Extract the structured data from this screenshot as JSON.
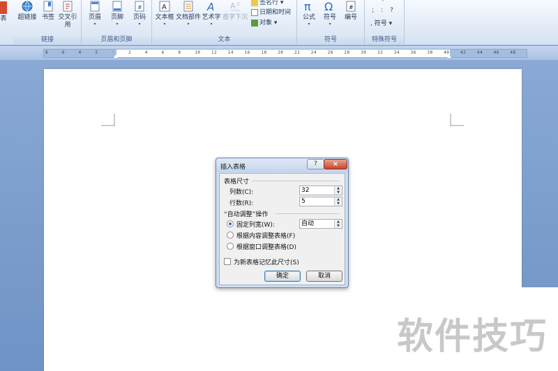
{
  "ribbon": {
    "groups": [
      {
        "id": "links",
        "label": "链接",
        "buttons": [
          "超链接",
          "书签",
          "交叉引用"
        ]
      },
      {
        "id": "header-footer",
        "label": "页眉和页脚",
        "buttons": [
          "页眉",
          "页脚",
          "页码"
        ]
      },
      {
        "id": "text",
        "label": "文本",
        "buttons": [
          "文本框",
          "文档部件",
          "艺术字",
          "首字下沉"
        ],
        "small": [
          "签名行",
          "日期和时间",
          "对象"
        ]
      },
      {
        "id": "symbols",
        "label": "符号",
        "buttons": [
          "公式",
          "符号",
          "编号"
        ]
      },
      {
        "id": "special",
        "label": "特殊符号",
        "small_symbol": "符号"
      }
    ],
    "left_partial": "表",
    "cross_ref_line2": "引用",
    "special_marks": [
      "°",
      "·",
      ";",
      "“",
      "?",
      ",",
      ":"
    ]
  },
  "ruler": {
    "ticks": [
      "8",
      "6",
      "4",
      "2",
      "",
      "2",
      "4",
      "6",
      "8",
      "10",
      "12",
      "14",
      "16",
      "18",
      "20",
      "22",
      "24",
      "26",
      "28",
      "30",
      "32",
      "34",
      "36",
      "38",
      "40",
      "42",
      "44",
      "46",
      "48"
    ]
  },
  "watermark": "软件技巧",
  "dialog": {
    "title": "插入表格",
    "help_label": "?",
    "close_label": "×",
    "table_size_heading": "表格尺寸",
    "columns_label": "列数",
    "columns_key": "(C):",
    "columns_value": "32",
    "rows_label": "行数",
    "rows_key": "(R):",
    "rows_value": "5",
    "autofit_heading": "“自动调整”操作",
    "fixed_width_label": "固定列宽",
    "fixed_width_key": "(W):",
    "fixed_width_value": "自动",
    "fit_content_label": "根据内容调整表格",
    "fit_content_key": "(F)",
    "fit_window_label": "根据窗口调整表格",
    "fit_window_key": "(D)",
    "remember_label": "为新表格记忆此尺寸",
    "remember_key": "(S)",
    "ok_label": "确定",
    "cancel_label": "取消"
  }
}
